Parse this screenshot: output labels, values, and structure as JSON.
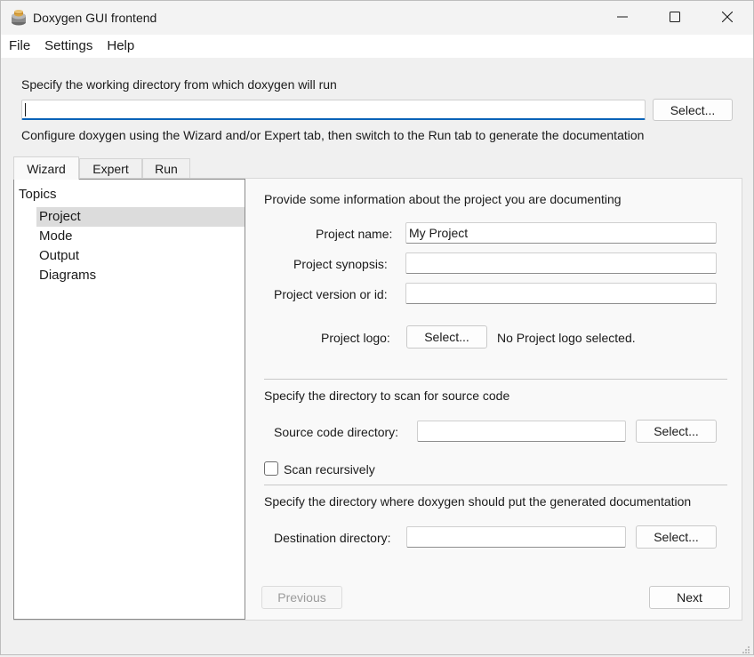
{
  "window": {
    "title": "Doxygen GUI frontend",
    "icon": "doxygen-app-icon",
    "controls": [
      "minimize-icon",
      "maximize-icon",
      "close-icon"
    ]
  },
  "menubar": {
    "items": [
      {
        "label": "File"
      },
      {
        "label": "Settings"
      },
      {
        "label": "Help"
      }
    ]
  },
  "workdir": {
    "prompt": "Specify the working directory from which doxygen will run",
    "value": "",
    "select_label": "Select...",
    "hint": "Configure doxygen using the Wizard and/or Expert tab, then switch to the Run tab to generate the documentation"
  },
  "tabs": [
    {
      "label": "Wizard",
      "active": true
    },
    {
      "label": "Expert",
      "active": false
    },
    {
      "label": "Run",
      "active": false
    }
  ],
  "topics": {
    "root": "Topics",
    "items": [
      {
        "label": "Project",
        "selected": true
      },
      {
        "label": "Mode",
        "selected": false
      },
      {
        "label": "Output",
        "selected": false
      },
      {
        "label": "Diagrams",
        "selected": false
      }
    ]
  },
  "project": {
    "intro": "Provide some information about the project you are documenting",
    "name_label": "Project name:",
    "name_value": "My Project",
    "synopsis_label": "Project synopsis:",
    "synopsis_value": "",
    "version_label": "Project version or id:",
    "version_value": "",
    "logo_label": "Project logo:",
    "logo_button": "Select...",
    "logo_status": "No Project logo selected."
  },
  "source": {
    "intro": "Specify the directory to scan for source code",
    "dir_label": "Source code directory:",
    "dir_value": "",
    "select_label": "Select...",
    "recursive_label": "Scan recursively",
    "recursive_checked": false
  },
  "destination": {
    "intro": "Specify the directory where doxygen should put the generated documentation",
    "dir_label": "Destination directory:",
    "dir_value": "",
    "select_label": "Select..."
  },
  "nav": {
    "previous_label": "Previous",
    "previous_enabled": false,
    "next_label": "Next"
  },
  "colors": {
    "focus_accent": "#0a63b8",
    "selection": "#dcdcdc"
  }
}
